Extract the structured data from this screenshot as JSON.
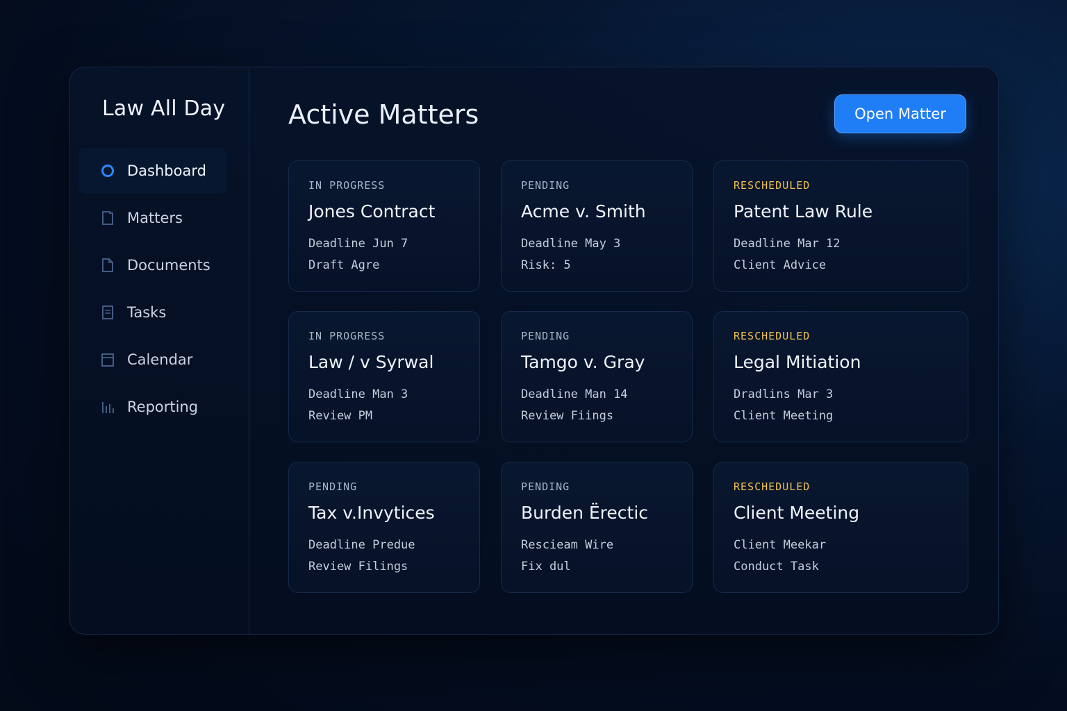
{
  "app": {
    "title": "Law All Day"
  },
  "colors": {
    "accent": "#1f7ef5",
    "warning": "#f2c14e",
    "background": "#040d1f"
  },
  "sidebar": {
    "items": [
      {
        "label": "Dashboard",
        "icon": "circle-icon",
        "active": true
      },
      {
        "label": "Matters",
        "icon": "folder-icon",
        "active": false
      },
      {
        "label": "Documents",
        "icon": "document-icon",
        "active": false
      },
      {
        "label": "Tasks",
        "icon": "checklist-icon",
        "active": false
      },
      {
        "label": "Calendar",
        "icon": "calendar-icon",
        "active": false
      },
      {
        "label": "Reporting",
        "icon": "bar-chart-icon",
        "active": false
      }
    ]
  },
  "main": {
    "title": "Active Matters",
    "open_button": "Open Matter",
    "cards": [
      {
        "status": "IN PROGRESS",
        "title": "Jones Contract",
        "line1": "Deadline Jun 7",
        "line2": "Draft Agre"
      },
      {
        "status": "PENDING",
        "title": "Acme v. Smith",
        "line1": "Deadline May 3",
        "line2": "Risk: 5"
      },
      {
        "status": "RESCHEDULED",
        "title": "Patent Law Rule",
        "line1": "Deadline Mar 12",
        "line2": "Client Advice"
      },
      {
        "status": "IN PROGRESS",
        "title": "Law / v Syrwal",
        "line1": "Deadline Man 3",
        "line2": "Review PM"
      },
      {
        "status": "PENDING",
        "title": "Tamgo v. Gray",
        "line1": "Deadline Man 14",
        "line2": "Review Fiings"
      },
      {
        "status": "RESCHEDULED",
        "title": "Legal Mitiation",
        "line1": "Dradlins Mar 3",
        "line2": "Client Meeting"
      },
      {
        "status": "PENDING",
        "title": "Tax v.Invytices",
        "line1": "Deadline Predue",
        "line2": "Review Filings"
      },
      {
        "status": "PENDING",
        "title": "Burden Ërectic",
        "line1": "Rescieam Wire",
        "line2": "Fix dul"
      },
      {
        "status": "RESCHEDULED",
        "title": "Client Meeting",
        "line1": "Client Meekar",
        "line2": "Conduct Task"
      }
    ]
  }
}
